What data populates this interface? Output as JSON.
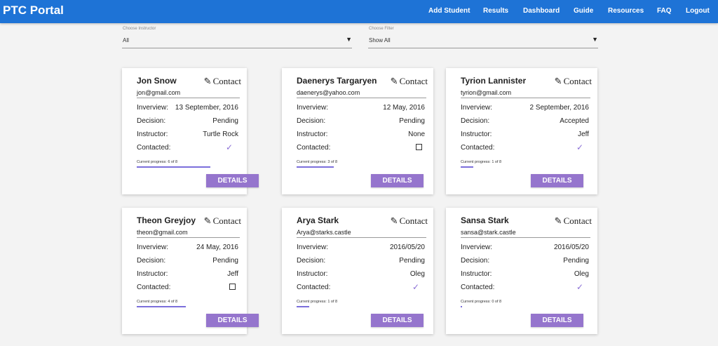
{
  "app": {
    "title": "PTC Portal"
  },
  "nav": [
    "Add Student",
    "Results",
    "Dashboard",
    "Guide",
    "Resources",
    "FAQ",
    "Logout"
  ],
  "filters": {
    "instructor": {
      "label": "Choose Instructor",
      "value": "All"
    },
    "filter": {
      "label": "Choose Filter",
      "value": "Show All"
    }
  },
  "labels": {
    "contact": "Contact",
    "interview": "Inverview:",
    "decision": "Decision:",
    "instructor": "Instructor:",
    "contacted": "Contacted:",
    "details": "DETAILS"
  },
  "cards": [
    {
      "name": "Jon Snow",
      "email": "jon@gmail.com",
      "interview": "13 September, 2016",
      "decision": "Pending",
      "instructor": "Turtle Rock",
      "contacted": true,
      "progress_text": "Current progress: 6 of 8",
      "progress": 0.75
    },
    {
      "name": "Daenerys Targaryen",
      "email": "daenerys@yahoo.com",
      "interview": "12 May, 2016",
      "decision": "Pending",
      "instructor": "None",
      "contacted": false,
      "progress_text": "Current progress: 3 of 8",
      "progress": 0.375
    },
    {
      "name": "Tyrion Lannister",
      "email": "tyrion@gmail.com",
      "interview": "2 September, 2016",
      "decision": "Accepted",
      "instructor": "Jeff",
      "contacted": true,
      "progress_text": "Current progress: 1 of 8",
      "progress": 0.125
    },
    {
      "name": "Theon Greyjoy",
      "email": "theon@gmail.com",
      "interview": "24 May, 2016",
      "decision": "Pending",
      "instructor": "Jeff",
      "contacted": false,
      "progress_text": "Current progress: 4 of 8",
      "progress": 0.5
    },
    {
      "name": "Arya Stark",
      "email": "Arya@starks.castle",
      "interview": "2016/05/20",
      "decision": "Pending",
      "instructor": "Oleg",
      "contacted": true,
      "progress_text": "Current progress: 1 of 8",
      "progress": 0.125
    },
    {
      "name": "Sansa Stark",
      "email": "sansa@stark.castle",
      "interview": "2016/05/20",
      "decision": "Pending",
      "instructor": "Oleg",
      "contacted": true,
      "progress_text": "Current progress: 0 of 8",
      "progress": 0.0
    }
  ],
  "icons": {
    "contact": "edit-icon",
    "dropdown": "caret-down-icon",
    "checked": "checkmark-icon",
    "unchecked": "checkbox-icon"
  },
  "colors": {
    "header": "#1e73d6",
    "accent": "#9575cd",
    "progress": "#7b6fdb"
  }
}
